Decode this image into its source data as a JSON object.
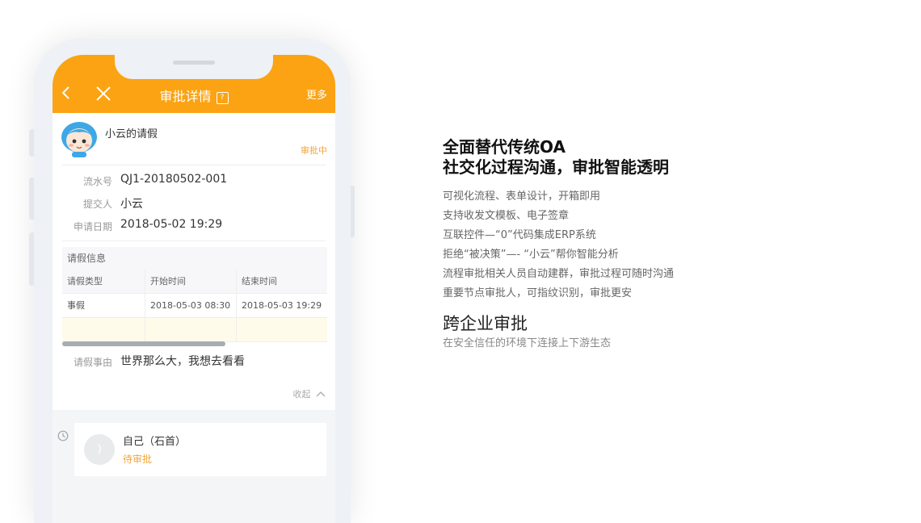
{
  "phone": {
    "header": {
      "title": "审批详情",
      "help_glyph": "?",
      "more_label": "更多"
    },
    "request": {
      "title": "小云的请假",
      "status": "审批中",
      "fields": [
        {
          "label": "流水号",
          "value": "QJ1-20180502-001"
        },
        {
          "label": "提交人",
          "value": "小云"
        },
        {
          "label": "申请日期",
          "value": "2018-05-02 19:29"
        }
      ]
    },
    "leave_table": {
      "title": "请假信息",
      "columns": [
        "请假类型",
        "开始时间",
        "结束时间"
      ],
      "rows": [
        [
          "事假",
          "2018-05-03 08:30",
          "2018-05-03 19:29"
        ]
      ]
    },
    "reason": {
      "label": "请假事由",
      "value": "世界那么大，我想去看看"
    },
    "collapse_label": "收起",
    "approver": {
      "name": "自己（石首）",
      "status": "待审批",
      "avatar_glyph": ")"
    }
  },
  "copy": {
    "headline_line1": "全面替代传统OA",
    "headline_line2": "社交化过程沟通，审批智能透明",
    "features": [
      "可视化流程、表单设计，开箱即用",
      "支持收发文模板、电子签章",
      "互联控件—“0”代码集成ERP系统",
      "拒绝“被决策”—- “小云”帮你智能分析",
      "流程审批相关人员自动建群，审批过程可随时沟通",
      "重要节点审批人，可指纹识别，审批更安"
    ],
    "section2_title": "跨企业审批",
    "section2_desc": "在安全信任的环境下连接上下游生态"
  },
  "colors": {
    "accent": "#fba313",
    "status": "#f3a53c"
  }
}
